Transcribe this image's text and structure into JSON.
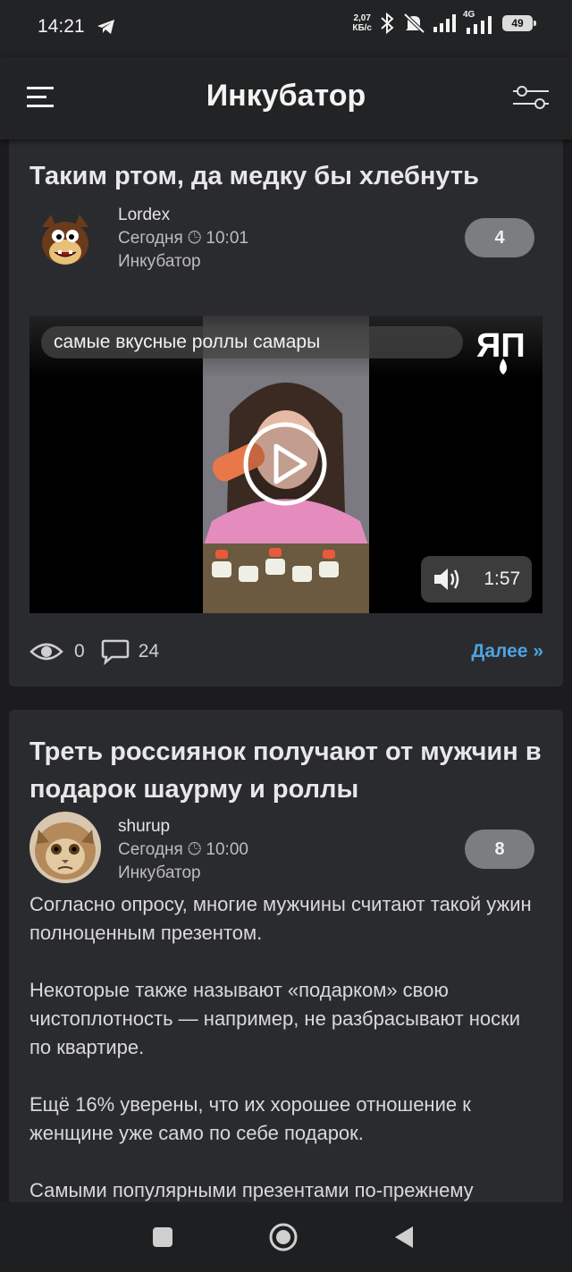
{
  "status": {
    "time": "14:21",
    "net_speed_value": "2,07",
    "net_speed_unit": "КБ/с",
    "network_label": "4G",
    "battery": "49"
  },
  "appbar": {
    "title": "Инкубатор"
  },
  "posts": [
    {
      "title": "Таким ртом, да медку бы хлебнуть",
      "author": "Lordex",
      "date": "Сегодня",
      "time": "10:01",
      "community": "Инкубатор",
      "rating": "4",
      "video": {
        "caption": "самые вкусные роллы самары",
        "duration": "1:57"
      },
      "views": "0",
      "comments": "24",
      "more": "Далее »"
    },
    {
      "title": "Треть россиянок получают от мужчин в подарок шаурму и роллы",
      "author": "shurup",
      "date": "Сегодня",
      "time": "10:00",
      "community": "Инкубатор",
      "rating": "8",
      "paragraphs": [
        "Согласно опросу, многие мужчины считают такой ужин полноценным презентом.",
        "Некоторые также называют «подарком» свою чистоплотность — например, не разбрасывают носки по квартире.",
        "Ещё 16% уверены, что их хорошее отношение к женщине уже само по себе подарок.",
        "Самыми популярными презентами по-прежнему"
      ]
    }
  ],
  "colors": {
    "accent": "#4fa3e0",
    "background": "#1c1c1e",
    "card": "#2a2b2e",
    "badge": "#7c7d80"
  }
}
